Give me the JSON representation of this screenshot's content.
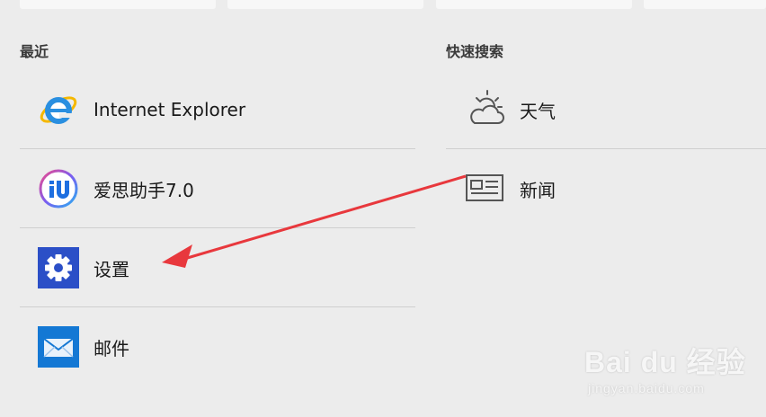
{
  "recent": {
    "title": "最近",
    "items": [
      {
        "label": "Internet Explorer",
        "icon": "internet-explorer-icon"
      },
      {
        "label": "爱思助手7.0",
        "icon": "i4-assistant-icon"
      },
      {
        "label": "设置",
        "icon": "settings-gear-icon"
      },
      {
        "label": "邮件",
        "icon": "mail-icon"
      }
    ]
  },
  "quick_search": {
    "title": "快速搜索",
    "items": [
      {
        "label": "天气",
        "icon": "weather-icon"
      },
      {
        "label": "新闻",
        "icon": "news-icon"
      }
    ]
  },
  "watermark": {
    "brand": "Bai du 经验",
    "url": "jingyan.baidu.com"
  },
  "colors": {
    "background": "#ececec",
    "arrow": "#e8383d",
    "settings_tile": "#2b4fc7",
    "mail_tile": "#1478d4"
  }
}
